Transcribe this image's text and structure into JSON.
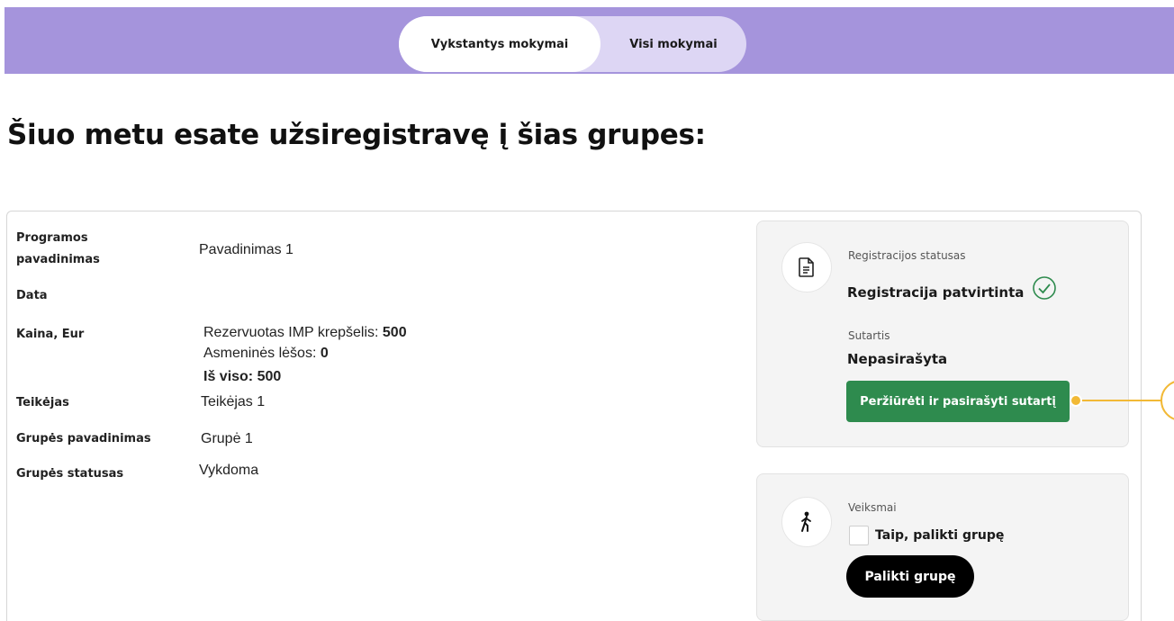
{
  "tabs": [
    {
      "label": "Vykstantys mokymai"
    },
    {
      "label": "Visi mokymai"
    }
  ],
  "page_title": "Šiuo metu esate užsiregistravę į šias grupes:",
  "details": {
    "program_label_line1": "Programos",
    "program_label_line2": "pavadinimas",
    "program_value": "Pavadinimas 1",
    "date_label": "Data",
    "price_label": "Kaina, Eur",
    "price_line1_text": "Rezervuotas IMP krepšelis: ",
    "price_line1_value": "500",
    "price_line2_text": "Asmeninės lėšos: ",
    "price_line2_value": "0",
    "price_total": "Iš viso: 500",
    "provider_label": "Teikėjas",
    "provider_value": "Teikėjas 1",
    "group_name_label": "Grupės pavadinimas",
    "group_name_value": "Grupė 1",
    "group_status_label": "Grupės statusas",
    "group_status_value": "Vykdoma"
  },
  "status_panel": {
    "icon": "document-icon",
    "registration_label": "Registracijos statusas",
    "registration_value": "Registracija patvirtinta",
    "contract_label": "Sutartis",
    "contract_value": "Nepasirašyta",
    "sign_button": "Peržiūrėti ir pasirašyti sutartį"
  },
  "actions_panel": {
    "icon": "walking-person-icon",
    "actions_label": "Veiksmai",
    "checkbox_label": "Taip, palikti grupę",
    "leave_button": "Palikti grupę"
  },
  "colors": {
    "topbar": "#a594dc",
    "green_button": "#2e8b4e",
    "highlight": "#f2b936"
  }
}
